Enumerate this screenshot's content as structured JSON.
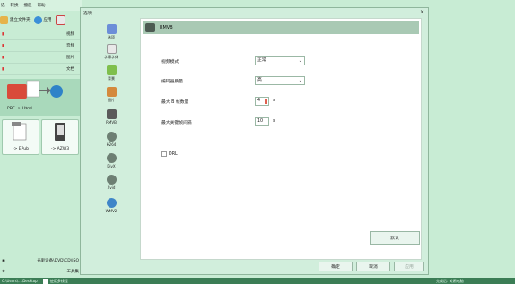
{
  "background_app": {
    "menu": [
      "选",
      "转换",
      "播放",
      "帮助"
    ],
    "toolbar": [
      {
        "label": "建立文件夹",
        "icon": "folder-icon"
      },
      {
        "label": "应用",
        "icon": "apply-icon"
      }
    ],
    "sidebar_rows": [
      "视频",
      "音频",
      "图片",
      "文档"
    ],
    "pdf_banner_label": "PDF -> Html",
    "conversions": [
      "-> EPub",
      "-> AZW3"
    ],
    "bottom_rows": [
      "光驱设备\\DVD\\CD\\ISO",
      "工具集"
    ]
  },
  "statusbar": {
    "path": "C:\\Users\\...\\Desktop",
    "checkbox_label": "使用多线程",
    "right_text": "完成后: 关闭电脑"
  },
  "dialog": {
    "title": "选项",
    "codecs": [
      {
        "label": "选项",
        "icon": "settings-icon",
        "color": "#6c8ed8"
      },
      {
        "label": "字幕字体",
        "icon": "subtitle-font-icon",
        "color": "#e8e8e8"
      },
      {
        "label": "背景",
        "icon": "background-icon",
        "color": "#7fbf4d"
      },
      {
        "label": "图片",
        "icon": "image-icon",
        "color": "#d4893c"
      },
      {
        "label": "RMVB",
        "icon": "rmvb-icon",
        "color": "#5a5a5a"
      },
      {
        "label": "H264",
        "icon": "h264-icon",
        "color": "#6d7f73"
      },
      {
        "label": "DivX",
        "icon": "divx-icon",
        "color": "#6d7f73"
      },
      {
        "label": "Xvid",
        "icon": "xvid-icon",
        "color": "#6d7f73"
      },
      {
        "label": "WMV2",
        "icon": "wmv2-icon",
        "color": "#3f85c8"
      }
    ],
    "panel": {
      "header": "RMVB",
      "fields": [
        {
          "label": "视频模式",
          "type": "select",
          "value": "正常"
        },
        {
          "label": "编码器质量",
          "type": "select",
          "value": "高"
        },
        {
          "label": "最大 B 帧数量",
          "type": "spin",
          "value": "4",
          "unit": "s"
        },
        {
          "label": "最大关键帧间隔",
          "type": "spin",
          "value": "10",
          "unit": "s"
        }
      ],
      "checkbox": {
        "label": "DRL",
        "checked": false
      }
    },
    "buttons": {
      "default": "默认",
      "ok": "确定",
      "cancel": "取消",
      "apply": "应用"
    }
  }
}
